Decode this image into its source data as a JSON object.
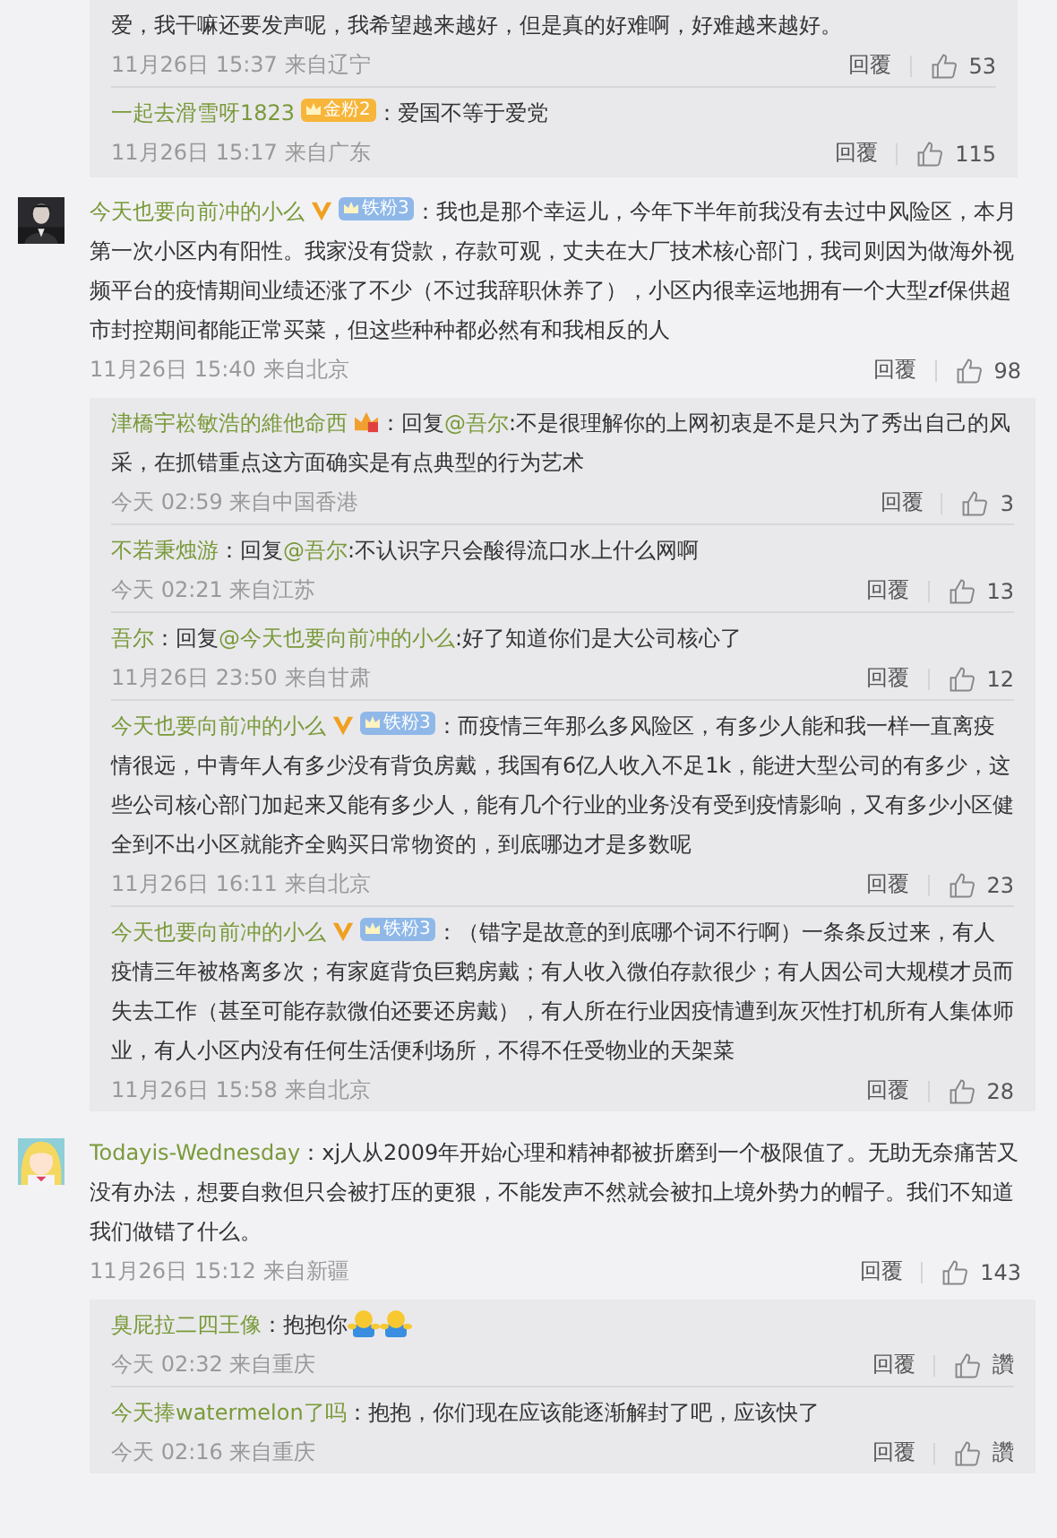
{
  "leading_replies": [
    {
      "text": "爱，我干嘛还要发声呢，我希望越来越好，但是真的好难啊，好难越来越好。",
      "time": "11月26日 15:37 来自辽宁",
      "reply_label": "回覆",
      "likes": "53"
    },
    {
      "user": "一起去滑雪呀1823",
      "badge": {
        "kind": "gold",
        "label": "金粉2"
      },
      "text": "：爱国不等于爱党",
      "time": "11月26日 15:17 来自广东",
      "reply_label": "回覆",
      "likes": "115"
    }
  ],
  "comments": [
    {
      "user": "今天也要向前冲的小么",
      "verified": true,
      "badge": {
        "kind": "iron",
        "label": "铁粉3"
      },
      "text": "：我也是那个幸运儿，今年下半年前我没有去过中风险区，本月第一次小区内有阳性。我家没有贷款，存款可观，丈夫在大厂技术核心部门，我司则因为做海外视频平台的疫情期间业绩还涨了不少（不过我辞职休养了），小区内很幸运地拥有一个大型zf保供超市封控期间都能正常买菜，但这些种种都必然有和我相反的人",
      "time": "11月26日 15:40 来自北京",
      "reply_label": "回覆",
      "likes": "98",
      "replies": [
        {
          "user": "津橋宇崧敏浩的維他命西",
          "badge": {
            "kind": "crown"
          },
          "prefix": "：回复",
          "mention": "@吾尔",
          "text": ":不是很理解你的上网初衷是不是只为了秀出自己的风采，在抓错重点这方面确实是有点典型的行为艺术",
          "time": "今天 02:59 来自中国香港",
          "reply_label": "回覆",
          "likes": "3"
        },
        {
          "user": "不若秉烛游",
          "prefix": "：回复",
          "mention": "@吾尔",
          "text": ":不认识字只会酸得流口水上什么网啊",
          "time": "今天 02:21 来自江苏",
          "reply_label": "回覆",
          "likes": "13"
        },
        {
          "user": "吾尔",
          "prefix": "：回复",
          "mention": "@今天也要向前冲的小么",
          "text": ":好了知道你们是大公司核心了",
          "time": "11月26日 23:50 来自甘肃",
          "reply_label": "回覆",
          "likes": "12"
        },
        {
          "user": "今天也要向前冲的小么",
          "verified": true,
          "badge": {
            "kind": "iron",
            "label": "铁粉3"
          },
          "text": "：而疫情三年那么多风险区，有多少人能和我一样一直离疫情很远，中青年人有多少没有背负房戴，我国有6亿人收入不足1k，能进大型公司的有多少，这些公司核心部门加起来又能有多少人，能有几个行业的业务没有受到疫情影响，又有多少小区健全到不出小区就能齐全购买日常物资的，到底哪边才是多数呢",
          "time": "11月26日 16:11 来自北京",
          "reply_label": "回覆",
          "likes": "23"
        },
        {
          "user": "今天也要向前冲的小么",
          "verified": true,
          "badge": {
            "kind": "iron",
            "label": "铁粉3"
          },
          "text": "：（错字是故意的到底哪个词不行啊）一条条反过来，有人疫情三年被格离多次；有家庭背负巨鹅房戴；有人收入微伯存款很少；有人因公司大规模才员而失去工作（甚至可能存款微伯还要还房戴），有人所在行业因疫情遭到灰灭性打机所有人集体师业，有人小区内没有任何生活便利场所，不得不任受物业的天架菜",
          "time": "11月26日 15:58 来自北京",
          "reply_label": "回覆",
          "likes": "28"
        }
      ]
    },
    {
      "user": "Todayis-Wednesday",
      "text": "：xj人从2009年开始心理和精神都被折磨到一个极限值了。无助无奈痛苦又没有办法，想要自救但只会被打压的更狠，不能发声不然就会被扣上境外势力的帽子。我们不知道我们做错了什么。",
      "time": "11月26日 15:12 来自新疆",
      "reply_label": "回覆",
      "likes": "143",
      "replies": [
        {
          "user": "臭屁拉二四王像",
          "text": "：抱抱你",
          "emojis": [
            {
              "kind": "hug"
            },
            {
              "kind": "hug"
            }
          ],
          "time": "今天 02:32 来自重庆",
          "reply_label": "回覆",
          "likes": "讚"
        },
        {
          "user": "今天捧watermelon了吗",
          "text": "：抱抱，你们现在应该能逐渐解封了吧，应该快了",
          "time": "今天 02:16 来自重庆",
          "reply_label": "回覆",
          "likes": "讚"
        }
      ]
    }
  ]
}
